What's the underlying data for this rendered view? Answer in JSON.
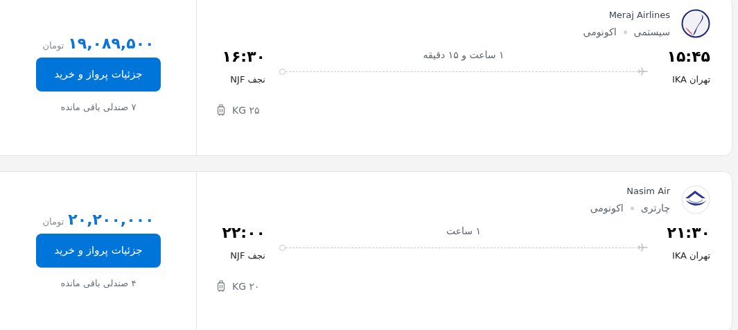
{
  "flights": [
    {
      "airline": "Meraj Airlines",
      "flight_type": "سیستمی",
      "cabin": "اکونومی",
      "departure": {
        "time": "۱۵:۴۵",
        "place": "تهران IKA"
      },
      "arrival": {
        "time": "۱۶:۳۰",
        "place": "نجف NJF"
      },
      "duration": "۱ ساعت و ۱۵ دقیقه",
      "baggage": "۲۵ KG",
      "price": "۱۹,۰۸۹,۵۰۰",
      "currency": "تومان",
      "button": "جزئیات پرواز و خرید",
      "seats_left": "۷ صندلی باقی مانده"
    },
    {
      "airline": "Nasim Air",
      "flight_type": "چارتری",
      "cabin": "اکونومی",
      "departure": {
        "time": "۲۱:۳۰",
        "place": "تهران IKA"
      },
      "arrival": {
        "time": "۲۲:۰۰",
        "place": "نجف NJF"
      },
      "duration": "۱ ساعت",
      "baggage": "۲۰ KG",
      "price": "۲۰,۲۰۰,۰۰۰",
      "currency": "تومان",
      "button": "جزئیات پرواز و خرید",
      "seats_left": "۴ صندلی باقی مانده"
    }
  ]
}
